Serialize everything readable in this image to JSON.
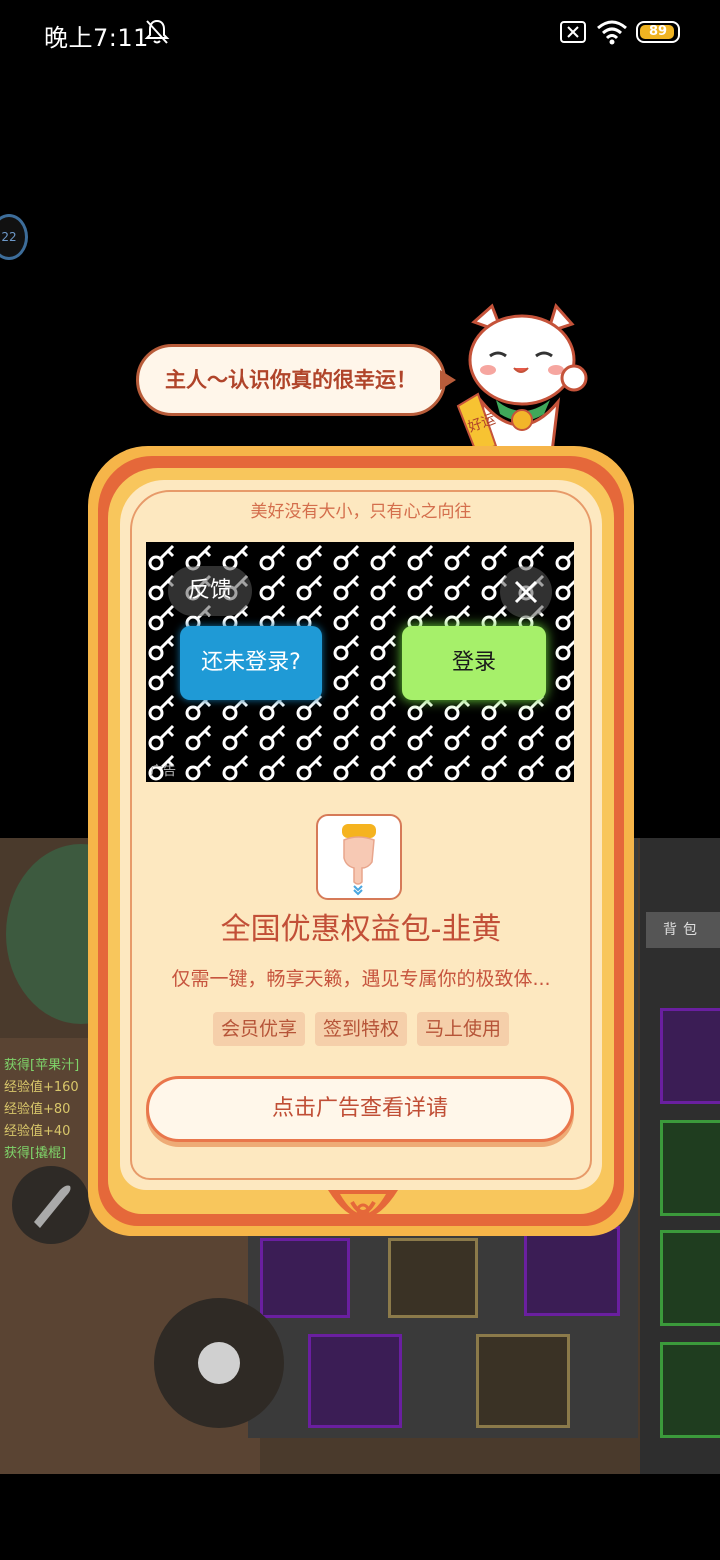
{
  "status_bar": {
    "time": "晚上7:11",
    "battery": "89"
  },
  "side_badge": "22",
  "speech": "主人～认识你真的很幸运！",
  "cat_banner": "好运",
  "dialog": {
    "motto": "美好没有大小，只有心之向往",
    "ad": {
      "feedback_label": "反馈",
      "not_logged_in_label": "还未登录?",
      "login_label": "登录",
      "ad_tag": "广告"
    },
    "app_title": "全国优惠权益包-韭黄",
    "app_desc": "仅需一键，畅享天籁，遇见专属你的极致体...",
    "tags": [
      "会员优享",
      "签到特权",
      "马上使用"
    ],
    "cta_label": "点击广告查看详请"
  },
  "game": {
    "bag_label": "背包",
    "log": [
      {
        "text": "获得[苹果汁]",
        "color": "#7fd46a"
      },
      {
        "text": "经验值+160",
        "color": "#d8c66a"
      },
      {
        "text": "经验值+80",
        "color": "#d8c66a"
      },
      {
        "text": "经验值+40",
        "color": "#d8c66a"
      },
      {
        "text": "获得[撬棍]",
        "color": "#7fd46a"
      }
    ]
  },
  "colors": {
    "accent_red": "#e5683a",
    "gold": "#f6b549",
    "panel": "#fde8c0",
    "login_green": "#a6f06a",
    "blue": "#1f9ad6"
  }
}
